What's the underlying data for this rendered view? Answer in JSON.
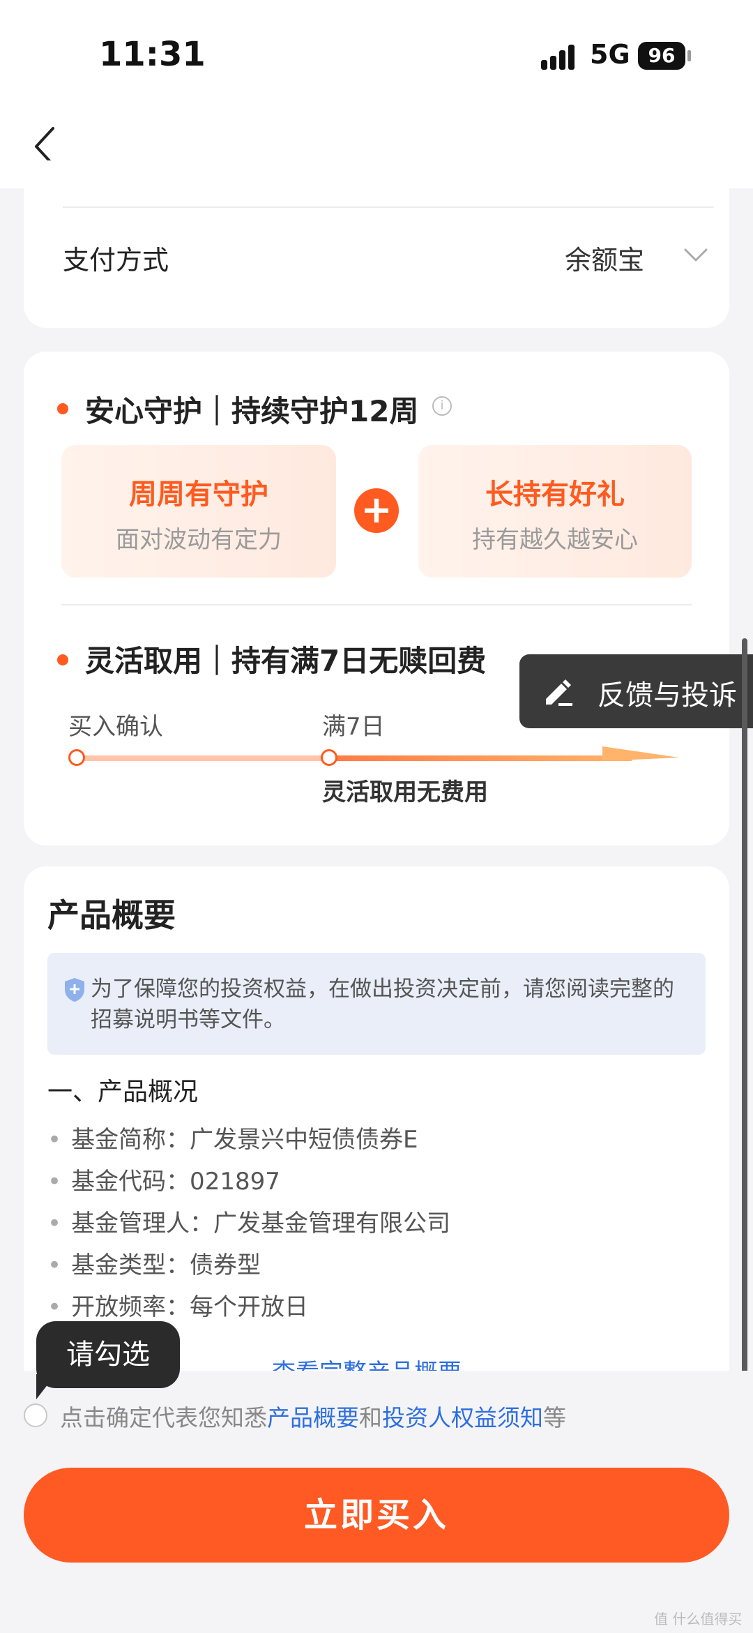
{
  "status_bar": {
    "time": "11:31",
    "network": "5G",
    "battery": "96"
  },
  "payment": {
    "label": "支付方式",
    "value": "余额宝"
  },
  "protection": {
    "title": "安心守护｜持续守护12周",
    "benefits": [
      {
        "title": "周周有守护",
        "subtitle": "面对波动有定力"
      },
      {
        "title": "长持有好礼",
        "subtitle": "持有越久越安心"
      }
    ]
  },
  "flexible": {
    "title": "灵活取用｜持有满7日无赎回费",
    "timeline": {
      "start_label": "买入确认",
      "mid_label": "满7日",
      "note": "灵活取用无费用"
    }
  },
  "feedback": {
    "label": "反馈与投诉"
  },
  "summary": {
    "title": "产品概要",
    "notice": "为了保障您的投资权益，在做出投资决定前，请您阅读完整的招募说明书等文件。",
    "section_title": "一、产品概况",
    "items": [
      "基金简称：广发景兴中短债债券E",
      "基金代码：021897",
      "基金管理人：广发基金管理有限公司",
      "基金类型：债券型",
      "开放频率：每个开放日"
    ],
    "more_link": "查看完整产品概要"
  },
  "agreement": {
    "tooltip": "请勾选",
    "prefix": "点击确定代表您知悉",
    "link1": "产品概要",
    "mid": "和",
    "link2": "投资人权益须知",
    "suffix": "等"
  },
  "buy_button": "立即买入",
  "watermark": "值 什么值得买"
}
